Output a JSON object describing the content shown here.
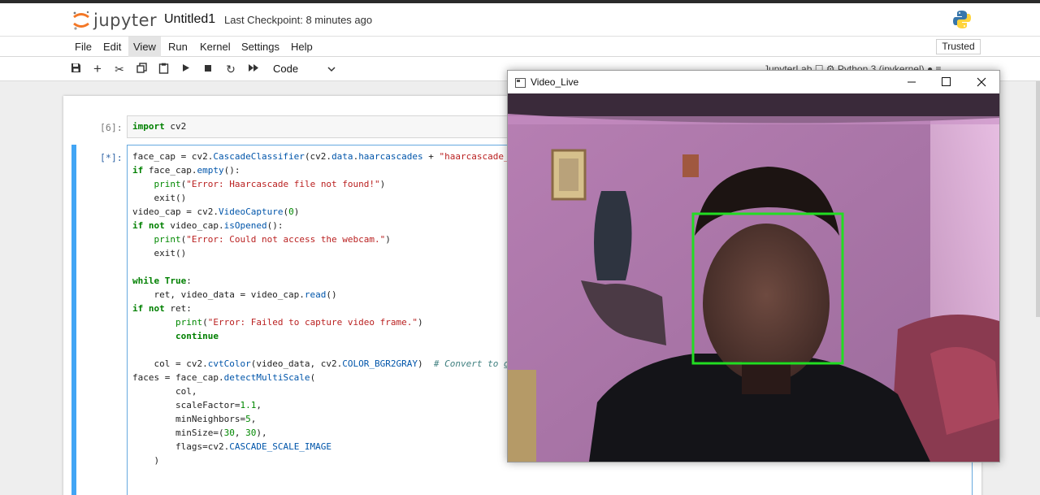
{
  "header": {
    "logo_text": "jupyter",
    "notebook_title": "Untitled1",
    "checkpoint": "Last Checkpoint: 8 minutes ago"
  },
  "menu": {
    "items": [
      "File",
      "Edit",
      "View",
      "Run",
      "Kernel",
      "Settings",
      "Help"
    ],
    "active": "View",
    "trusted": "Trusted"
  },
  "toolbar": {
    "icons": [
      "save-icon",
      "add-cell-icon",
      "cut-icon",
      "copy-icon",
      "paste-icon",
      "run-icon",
      "stop-icon",
      "restart-icon",
      "fast-forward-icon"
    ],
    "cell_type": "Code",
    "kernel_text": "JupyterLab ☐  ⚙  Python 3 (ipykernel) ● ≡"
  },
  "cells": [
    {
      "prompt": "[6]:"
    },
    {
      "prompt": "[*]:"
    }
  ],
  "video_window": {
    "title": "Video_Live",
    "detection_color": "#22dd22"
  },
  "colors": {
    "accent": "#42a5f5",
    "keyword": "#008000",
    "string": "#ba2121"
  }
}
